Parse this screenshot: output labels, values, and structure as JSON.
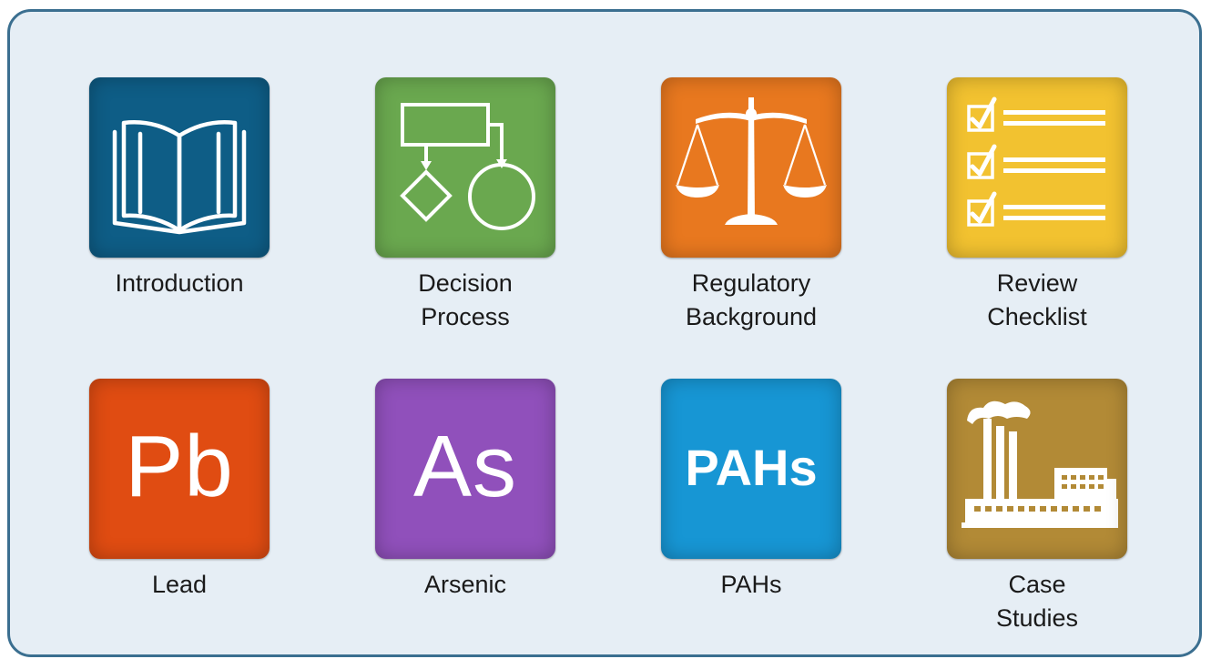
{
  "tiles": [
    {
      "id": "introduction",
      "color": "#0e5d86",
      "icon": "open-book-icon",
      "label_lines": [
        "Introduction"
      ]
    },
    {
      "id": "decision-process",
      "color": "#6aa84f",
      "icon": "flowchart-icon",
      "label_lines": [
        "Decision",
        "Process"
      ]
    },
    {
      "id": "regulatory-background",
      "color": "#e8781f",
      "icon": "scales-of-justice-icon",
      "label_lines": [
        "Regulatory",
        "Background"
      ]
    },
    {
      "id": "review-checklist",
      "color": "#f2c230",
      "icon": "checklist-icon",
      "label_lines": [
        "Review",
        "Checklist"
      ]
    },
    {
      "id": "lead",
      "color": "#e04c12",
      "icon_text": "Pb",
      "label_lines": [
        "Lead"
      ]
    },
    {
      "id": "arsenic",
      "color": "#9050bb",
      "icon_text": "As",
      "label_lines": [
        "Arsenic"
      ]
    },
    {
      "id": "pahs",
      "color": "#1796d4",
      "icon_text": "PAHs",
      "label_lines": [
        "PAHs"
      ]
    },
    {
      "id": "case-studies",
      "color": "#b28a36",
      "icon": "factory-icon",
      "label_lines": [
        "Case",
        "Studies"
      ]
    }
  ]
}
